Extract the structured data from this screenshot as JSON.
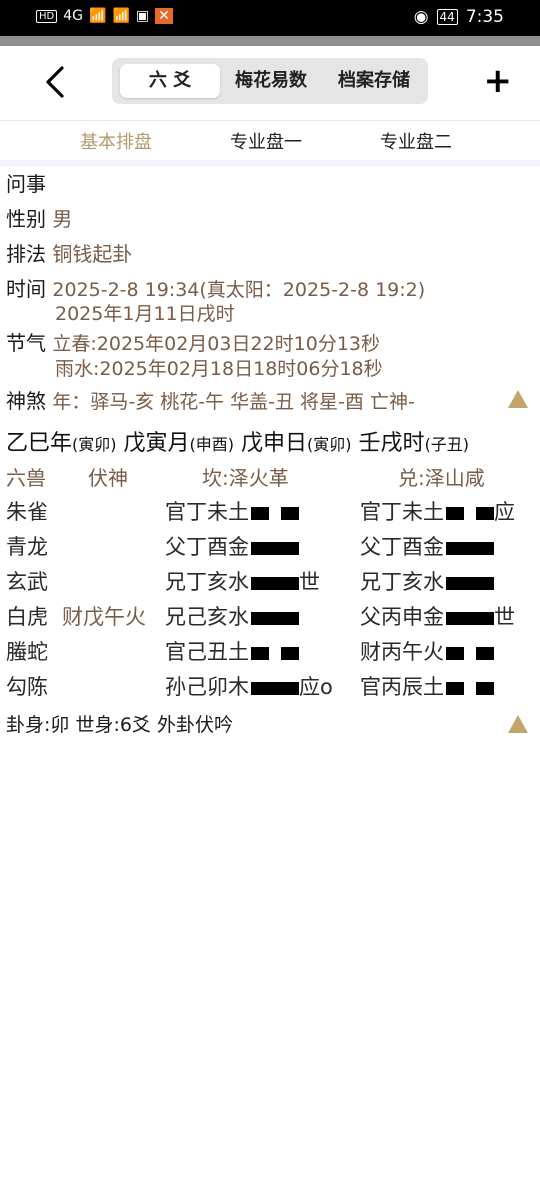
{
  "status": {
    "left": [
      "HD",
      "4G",
      "📶",
      "📶",
      "▣",
      "✕"
    ],
    "battery": "44",
    "time": "7:35"
  },
  "nav": {
    "tabs": [
      "六 爻",
      "梅花易数",
      "档案存储"
    ],
    "plus": "+"
  },
  "subtabs": [
    "基本排盘",
    "专业盘一",
    "专业盘二"
  ],
  "info": {
    "ask_label": "问事",
    "sex_label": "性别",
    "sex_value": "男",
    "method_label": "排法",
    "method_value": "铜钱起卦",
    "time_label": "时间",
    "time_line1": "2025-2-8 19:34(真太阳：2025-2-8 19:2)",
    "time_line2": "2025年1月11日戌时",
    "jieqi_label": "节气",
    "jieqi_line1": "立春:2025年02月03日22时10分13秒",
    "jieqi_line2": "雨水:2025年02月18日18时06分18秒",
    "shensha_label": "神煞",
    "shensha_value": "年：驿马-亥 桃花-午 华盖-丑 将星-酉 亡神-"
  },
  "ganzhi": [
    {
      "main": "乙巳年",
      "sub": "(寅卯)"
    },
    {
      "main": "戊寅月",
      "sub": "(申酉)"
    },
    {
      "main": "戊申日",
      "sub": "(寅卯)"
    },
    {
      "main": "壬戌时",
      "sub": "(子丑)"
    }
  ],
  "headers": {
    "beasts": "六兽",
    "fushen": "伏神",
    "main_gua": "坎:泽火革",
    "change_gua": "兑:泽山咸"
  },
  "rows": [
    {
      "beast": "朱雀",
      "fushen": "",
      "main": "官丁未土",
      "main_line": "yin",
      "main_mark": "",
      "change": "官丁未土",
      "change_line": "yin",
      "change_mark": "应"
    },
    {
      "beast": "青龙",
      "fushen": "",
      "main": "父丁酉金",
      "main_line": "yang",
      "main_mark": "",
      "change": "父丁酉金",
      "change_line": "yang",
      "change_mark": ""
    },
    {
      "beast": "玄武",
      "fushen": "",
      "main": "兄丁亥水",
      "main_line": "yang",
      "main_mark": "世",
      "change": "兄丁亥水",
      "change_line": "yang",
      "change_mark": ""
    },
    {
      "beast": "白虎",
      "fushen": "财戊午火",
      "main": "兄己亥水",
      "main_line": "yang",
      "main_mark": "",
      "change": "父丙申金",
      "change_line": "yang",
      "change_mark": "世"
    },
    {
      "beast": "螣蛇",
      "fushen": "",
      "main": "官己丑土",
      "main_line": "yin",
      "main_mark": "",
      "change": "财丙午火",
      "change_line": "yin",
      "change_mark": ""
    },
    {
      "beast": "勾陈",
      "fushen": "",
      "main": "孙己卯木",
      "main_line": "yang",
      "main_mark": "应o",
      "change": "官丙辰土",
      "change_line": "yin",
      "change_mark": ""
    }
  ],
  "footer": "卦身:卯 世身:6爻 外卦伏吟",
  "colors": {
    "accent": "#b39a68",
    "value_text": "#7a5c48",
    "triangle": "#c2a56b"
  }
}
